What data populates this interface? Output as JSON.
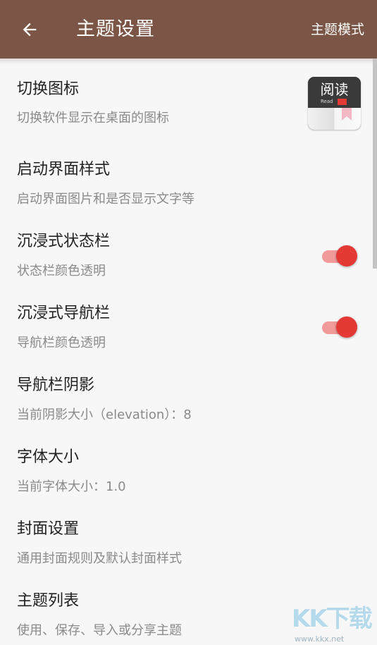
{
  "toolbar": {
    "title": "主题设置",
    "theme_mode_label": "主题模式",
    "back_icon": "arrow-left-icon",
    "background_color": "#7b5545"
  },
  "preferences": [
    {
      "title": "切换图标",
      "summary": "切换软件显示在桌面的图标"
    },
    {
      "title": "启动界面样式",
      "summary": "启动界面图片和是否显示文字等"
    },
    {
      "title": "沉浸式状态栏",
      "summary": "状态栏颜色透明",
      "switch_on": true
    },
    {
      "title": "沉浸式导航栏",
      "summary": "导航栏颜色透明",
      "switch_on": true
    },
    {
      "title": "导航栏阴影",
      "summary": "当前阴影大小（elevation）：8"
    },
    {
      "title": "字体大小",
      "summary": "当前字体大小：1.0"
    },
    {
      "title": "封面设置",
      "summary": "通用封面规则及默认封面样式"
    },
    {
      "title": "主题列表",
      "summary": "使用、保存、导入或分享主题"
    }
  ],
  "app_icon": {
    "text": "阅读",
    "sub_text": "Read"
  },
  "accent_color": "#e53935",
  "watermark": {
    "logo": "KK下载",
    "url": "www.kkx.net"
  }
}
